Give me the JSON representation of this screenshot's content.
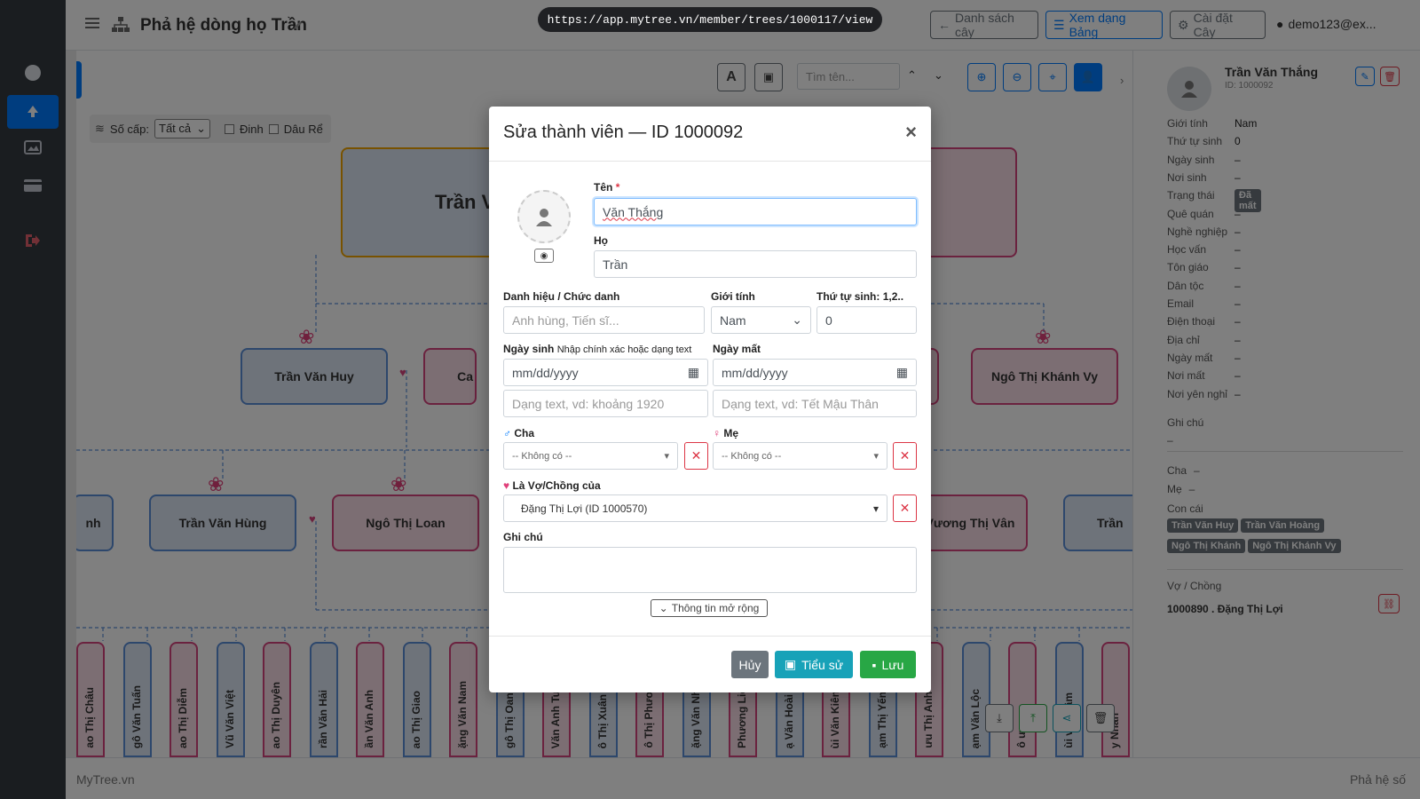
{
  "app": {
    "title": "Phả hệ dòng họ Trần",
    "url": "https://app.mytree.vn/member/trees/1000117/view",
    "user": "demo123@ex...",
    "footer_left": "MyTree.vn",
    "footer_right": "Phả hệ số"
  },
  "topbar": {
    "tree_list": "Danh sách cây",
    "table_view": "Xem dạng Bảng",
    "tree_settings": "Cài đặt Cây"
  },
  "toolbar": {
    "level_label": "Số cấp:",
    "level_value": "Tất cả",
    "chk_dinh": "Đinh",
    "chk_daure": "Dâu Rể",
    "search_placeholder": "Tìm tên..."
  },
  "tree": {
    "top_partial": "Trần V",
    "row2": [
      "Trần Văn Huy",
      "Ngô Thị Khánh Vy"
    ],
    "row2_partial": "Ca",
    "row3": [
      "nh",
      "Trần Văn Hùng",
      "Ngô Thị Loan",
      "Vương Thị Vân",
      "Trần"
    ],
    "row4": [
      "ao Thị Châu",
      "gô Văn Tuấn",
      "ao Thị Diễm",
      "Vũ Văn Việt",
      "ao Thị Duyên",
      "rần Văn Hải",
      "ần Văn Anh",
      "ao Thị Giao",
      "ặng Văn Nam",
      "gô Thị Oanh",
      "Văn Anh Tu",
      "ô Thị Xuân",
      "ô Thị Phươ",
      "ặng Văn Nhậ",
      "Phương Liê",
      "ạ Văn Hoài",
      "ùi Văn Kiên",
      "ạm Thị Yến",
      "ưu Thị Anh",
      "ạm Văn Lộc",
      "ô ượng",
      "ùi văn Lâm",
      "y Nhân"
    ]
  },
  "panel": {
    "name": "Trần Văn Thắng",
    "id": "ID: 1000092",
    "fields": [
      {
        "k": "Giới tính",
        "v": "Nam"
      },
      {
        "k": "Thứ tự sinh",
        "v": "0"
      },
      {
        "k": "Ngày sinh",
        "v": "–"
      },
      {
        "k": "Nơi sinh",
        "v": "–"
      },
      {
        "k": "Trạng thái",
        "v": "Đã mất",
        "badge": true
      },
      {
        "k": "Quê quán",
        "v": "–"
      },
      {
        "k": "Nghề nghiệp",
        "v": "–"
      },
      {
        "k": "Học vấn",
        "v": "–"
      },
      {
        "k": "Tôn giáo",
        "v": "–"
      },
      {
        "k": "Dân tộc",
        "v": "–"
      },
      {
        "k": "Email",
        "v": "–"
      },
      {
        "k": "Điện thoại",
        "v": "–"
      },
      {
        "k": "Địa chỉ",
        "v": "–"
      },
      {
        "k": "Ngày mất",
        "v": "–"
      },
      {
        "k": "Nơi mất",
        "v": "–"
      },
      {
        "k": "Nơi yên nghỉ",
        "v": "–"
      }
    ],
    "note_label": "Ghi chú",
    "note_value": "–",
    "father_label": "Cha",
    "father_value": "–",
    "mother_label": "Mẹ",
    "mother_value": "–",
    "children_label": "Con cái",
    "children": [
      "Trần Văn Huy",
      "Trần Văn Hoàng",
      "Ngô Thị Khánh",
      "Ngô Thị Khánh Vy"
    ],
    "spouse_label": "Vợ / Chồng",
    "spouse_value": "1000890 . Đặng Thị Lợi"
  },
  "modal": {
    "title": "Sửa thành viên — ID 1000092",
    "first_name_label": "Tên",
    "first_name_value": "Văn Thắng",
    "last_name_label": "Họ",
    "last_name_value": "Trần",
    "title_label": "Danh hiệu / Chức danh",
    "title_placeholder": "Anh hùng, Tiến sĩ...",
    "gender_label": "Giới tính",
    "gender_value": "Nam",
    "birth_order_label": "Thứ tự sinh: 1,2..",
    "birth_order_value": "0",
    "dob_label": "Ngày sinh",
    "dob_hint": "Nhập chính xác hoặc dạng text",
    "dob_placeholder": "mm/dd/yyyy",
    "dob_text_placeholder": "Dạng text, vd: khoảng 1920",
    "dod_label": "Ngày mất",
    "dod_placeholder": "mm/dd/yyyy",
    "dod_text_placeholder": "Dạng text, vd: Tết Mậu Thân",
    "father_label": "Cha",
    "father_value": "-- Không có --",
    "mother_label": "Mẹ",
    "mother_value": "-- Không có --",
    "spouse_label": "Là Vợ/Chồng của",
    "spouse_value": "Đặng Thị Lợi (ID 1000570)",
    "note_label": "Ghi chú",
    "expand_label": "Thông tin mở rộng",
    "cancel": "Hủy",
    "bio": "Tiểu sử",
    "save": "Lưu"
  }
}
